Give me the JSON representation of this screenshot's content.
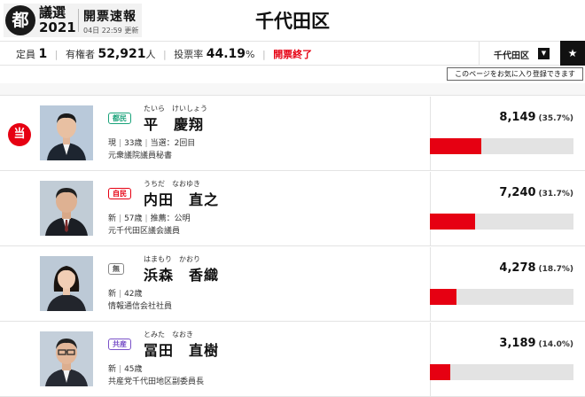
{
  "header": {
    "logo_mark": "都",
    "logo_giin": "議選",
    "logo_year": "2021",
    "logo_title": "開票速報",
    "updated": "04日 22:59 更新",
    "district": "千代田区"
  },
  "stats": {
    "seats_label": "定員",
    "seats": "1",
    "voters_label": "有権者",
    "voters": "52,921",
    "voters_unit": "人",
    "turnout_label": "投票率",
    "turnout": "44.19",
    "turnout_unit": "%",
    "status": "開票終了"
  },
  "district_select": {
    "label": "千代田区",
    "arrow": "▼"
  },
  "favorite": {
    "icon": "★",
    "tooltip": "このページをお気に入り登録できます"
  },
  "colors": {
    "accent_red": "#e60012",
    "party_tomin": "#1aa37a",
    "party_jimin": "#e60012",
    "party_mu": "#555555",
    "party_kyosan": "#7a52c8"
  },
  "candidates": [
    {
      "elected": true,
      "elected_label": "当",
      "party": "都民",
      "party_color": "#1aa37a",
      "furigana": "たいら　けいしょう",
      "name": "平　慶翔",
      "status": "現",
      "age": "33歳",
      "extra": "当選：2回目",
      "career": "元衆議院議員秘書",
      "votes": "8,149",
      "pct": "(35.7%)",
      "share": 35.7
    },
    {
      "elected": false,
      "elected_label": "",
      "party": "自民",
      "party_color": "#e60012",
      "furigana": "うちだ　なおゆき",
      "name": "内田　直之",
      "status": "新",
      "age": "57歳",
      "extra": "推薦：公明",
      "career": "元千代田区議会議員",
      "votes": "7,240",
      "pct": "(31.7%)",
      "share": 31.7
    },
    {
      "elected": false,
      "elected_label": "",
      "party": "無",
      "party_color": "#555555",
      "furigana": "はまもり　かおり",
      "name": "浜森　香織",
      "status": "新",
      "age": "42歳",
      "extra": "",
      "career": "情報通信会社社員",
      "votes": "4,278",
      "pct": "(18.7%)",
      "share": 18.7
    },
    {
      "elected": false,
      "elected_label": "",
      "party": "共産",
      "party_color": "#7a52c8",
      "furigana": "とみた　なおき",
      "name": "冨田　直樹",
      "status": "新",
      "age": "45歳",
      "extra": "",
      "career": "共産党千代田地区副委員長",
      "votes": "3,189",
      "pct": "(14.0%)",
      "share": 14.0
    }
  ]
}
